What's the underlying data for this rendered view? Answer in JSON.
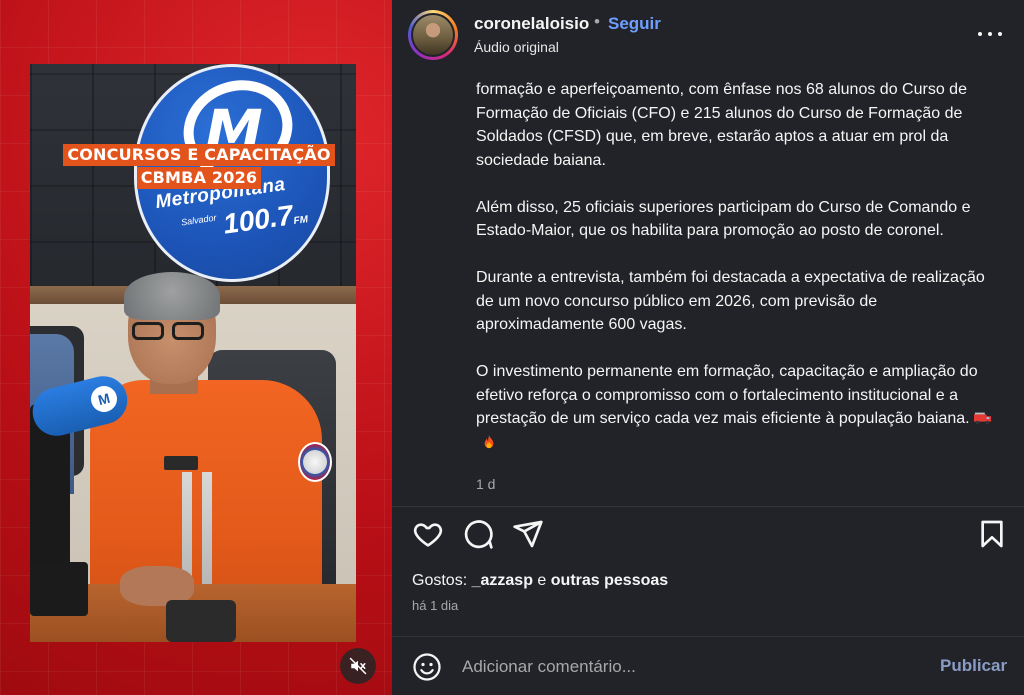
{
  "media": {
    "caption_line1": "CONCURSOS E CAPACITAÇÃO",
    "caption_line2": "CBMBA 2026",
    "station_name": "Metropolitana",
    "station_city": "Salvador",
    "station_frequency": "100.7",
    "station_band": "FM",
    "mic_logo_letter": "M",
    "mute_icon": "speaker-muted-icon"
  },
  "post": {
    "username": "coronelaloisio",
    "separator": "•",
    "follow_label": "Seguir",
    "audio_label": "Áudio original",
    "paragraphs": [
      "formação e aperfeiçoamento, com ênfase nos 68 alunos do Curso de Formação de Oficiais (CFO) e 215 alunos do Curso de Formação de Soldados (CFSD) que, em breve, estarão aptos a atuar em prol da sociedade baiana.",
      "Além disso, 25 oficiais superiores participam do Curso de Comando e Estado-Maior, que os habilita para promoção ao posto de coronel.",
      "Durante a entrevista, também foi destacada a expectativa de realização de um novo concurso público em 2026, com previsão de aproximadamente 600 vagas.",
      "O investimento permanente em formação, capacitação e ampliação do efetivo reforça o compromisso com o fortalecimento institucional e a prestação de um serviço cada vez mais eficiente à população baiana."
    ],
    "relative_time": "1 d",
    "likes_prefix": "Gostos:",
    "likes_user": "_azzasp",
    "likes_connector": "e",
    "likes_others": "outras pessoas",
    "posted_ago": "há 1 dia",
    "comment_placeholder": "Adicionar comentário...",
    "publish_label": "Publicar"
  },
  "colors": {
    "panel_bg": "#212328",
    "media_bg": "#c8141a",
    "follow": "#6f9eff",
    "muted_text": "#a8a8a8",
    "caption_bg": "#e3541c"
  }
}
